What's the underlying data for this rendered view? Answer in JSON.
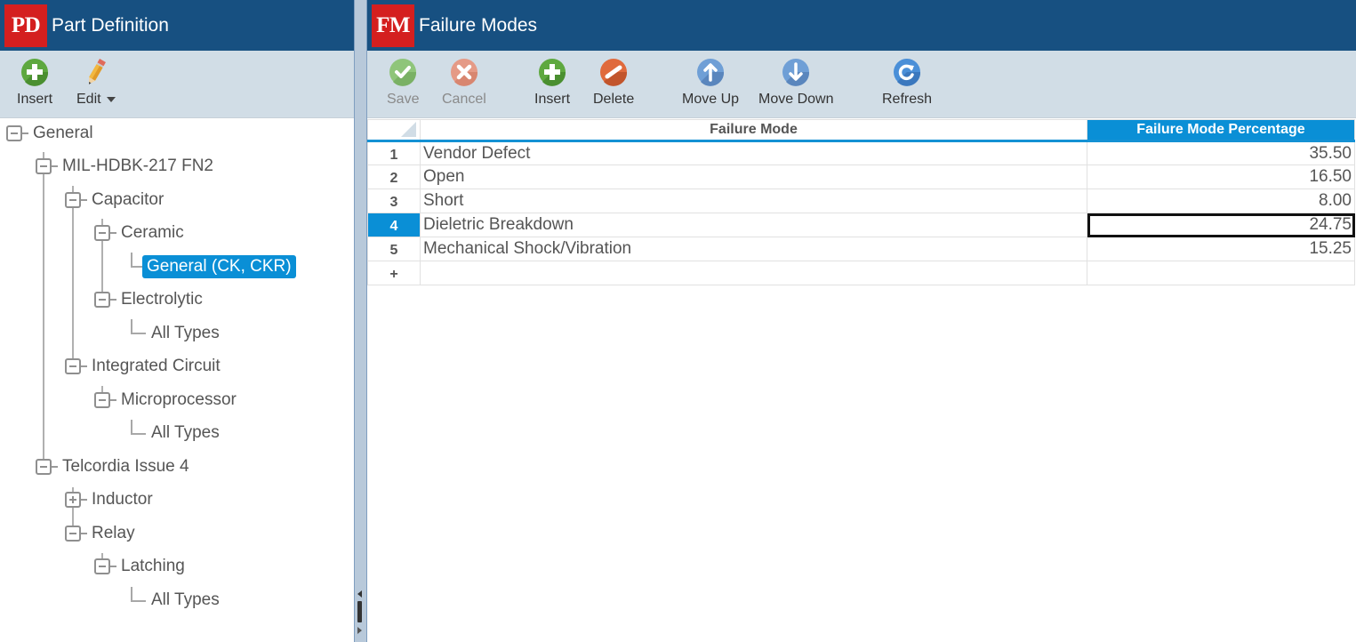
{
  "left_panel": {
    "logo": "PD",
    "title": "Part Definition",
    "toolbar": {
      "insert_label": "Insert",
      "edit_label": "Edit"
    },
    "tree": [
      {
        "label": "General",
        "level": 0,
        "toggle": "minus"
      },
      {
        "label": "MIL-HDBK-217 FN2",
        "level": 1,
        "toggle": "minus"
      },
      {
        "label": "Capacitor",
        "level": 2,
        "toggle": "minus"
      },
      {
        "label": "Ceramic",
        "level": 3,
        "toggle": "minus"
      },
      {
        "label": "General (CK, CKR)",
        "level": 4,
        "toggle": "none",
        "selected": true
      },
      {
        "label": "Electrolytic",
        "level": 3,
        "toggle": "minus"
      },
      {
        "label": "All Types",
        "level": 4,
        "toggle": "none"
      },
      {
        "label": "Integrated Circuit",
        "level": 2,
        "toggle": "minus"
      },
      {
        "label": "Microprocessor",
        "level": 3,
        "toggle": "minus"
      },
      {
        "label": "All Types",
        "level": 4,
        "toggle": "none"
      },
      {
        "label": "Telcordia Issue 4",
        "level": 1,
        "toggle": "minus"
      },
      {
        "label": "Inductor",
        "level": 2,
        "toggle": "plus"
      },
      {
        "label": "Relay",
        "level": 2,
        "toggle": "minus"
      },
      {
        "label": "Latching",
        "level": 3,
        "toggle": "minus"
      },
      {
        "label": "All Types",
        "level": 4,
        "toggle": "none"
      }
    ]
  },
  "right_panel": {
    "logo": "FM",
    "title": "Failure Modes",
    "toolbar": {
      "save_label": "Save",
      "cancel_label": "Cancel",
      "insert_label": "Insert",
      "delete_label": "Delete",
      "move_up_label": "Move Up",
      "move_down_label": "Move Down",
      "refresh_label": "Refresh"
    },
    "grid": {
      "columns": [
        "Failure Mode",
        "Failure Mode Percentage"
      ],
      "rows": [
        {
          "num": "1",
          "mode": "Vendor Defect",
          "pct": "35.50"
        },
        {
          "num": "2",
          "mode": "Open",
          "pct": "16.50"
        },
        {
          "num": "3",
          "mode": "Short",
          "pct": "8.00"
        },
        {
          "num": "4",
          "mode": "Dieletric Breakdown",
          "pct": "24.75"
        },
        {
          "num": "5",
          "mode": "Mechanical Shock/Vibration",
          "pct": "15.25"
        }
      ],
      "new_row_marker": "+",
      "selected_row": 4
    }
  },
  "colors": {
    "header_bg": "#175081",
    "toolbar_bg": "#d1dde6",
    "logo_bg": "#d41f1f",
    "accent": "#0a8fd6"
  }
}
